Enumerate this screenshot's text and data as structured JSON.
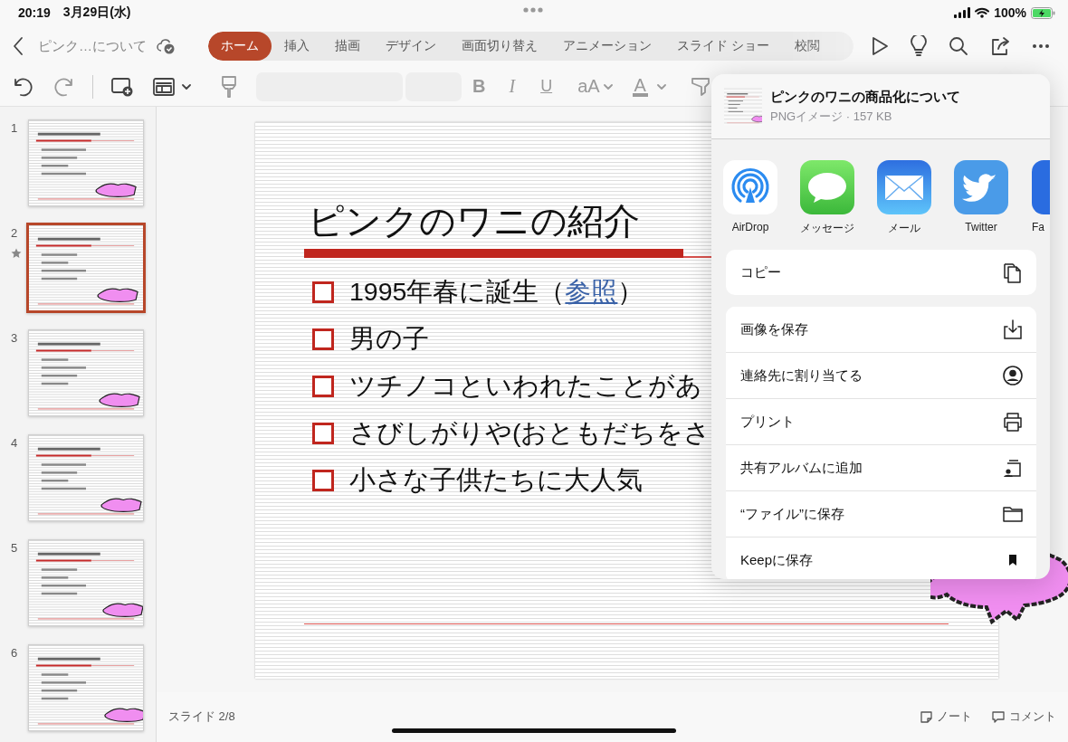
{
  "status_bar": {
    "time": "20:19",
    "date": "3月29日(水)",
    "battery": "100%"
  },
  "toolbar": {
    "document_title": "ピンク…について",
    "tabs": [
      {
        "label": "ホーム",
        "selected": true
      },
      {
        "label": "挿入",
        "selected": false
      },
      {
        "label": "描画",
        "selected": false
      },
      {
        "label": "デザイン",
        "selected": false
      },
      {
        "label": "画面切り替え",
        "selected": false
      },
      {
        "label": "アニメーション",
        "selected": false
      },
      {
        "label": "スライド ショー",
        "selected": false
      },
      {
        "label": "校閲",
        "selected": false
      }
    ]
  },
  "ribbon": {
    "tools": [
      {
        "kind": "undo",
        "disabled": false
      },
      {
        "kind": "redo",
        "disabled": true
      },
      {
        "kind": "new-slide",
        "disabled": false
      },
      {
        "kind": "layout",
        "disabled": false
      },
      {
        "kind": "format-painter",
        "disabled": true
      },
      {
        "kind": "font-name",
        "disabled": true
      },
      {
        "kind": "font-size",
        "disabled": true
      },
      {
        "kind": "bold",
        "label": "B",
        "disabled": true
      },
      {
        "kind": "italic",
        "label": "I",
        "disabled": true
      },
      {
        "kind": "underline",
        "label": "U",
        "disabled": true
      },
      {
        "kind": "size-change",
        "label": "aA",
        "disabled": true
      },
      {
        "kind": "font-color",
        "label": "A",
        "disabled": true
      },
      {
        "kind": "highlight",
        "disabled": true
      }
    ]
  },
  "slides": [
    {
      "number": "1",
      "selected": false,
      "starred": false
    },
    {
      "number": "2",
      "selected": true,
      "starred": true
    },
    {
      "number": "3",
      "selected": false,
      "starred": false
    },
    {
      "number": "4",
      "selected": false,
      "starred": false
    },
    {
      "number": "5",
      "selected": false,
      "starred": false
    },
    {
      "number": "6",
      "selected": false,
      "starred": false
    }
  ],
  "slide": {
    "title": "ピンクのワニの紹介",
    "bullets": [
      {
        "text": "1995年春に誕生（",
        "link": "参照",
        "tail": "）"
      },
      {
        "text": "男の子"
      },
      {
        "text": "ツチノコといわれたことがあ"
      },
      {
        "text": "さびしがりや(おともだちをさ"
      },
      {
        "text": "小さな子供たちに大人気"
      }
    ]
  },
  "footer": {
    "slide_indicator": "スライド 2/8",
    "notes": "ノート",
    "comments": "コメント"
  },
  "share_sheet": {
    "file_title": "ピンクのワニの商品化について",
    "file_info": "PNGイメージ · 157 KB",
    "apps": [
      {
        "kind": "airdrop",
        "label": "AirDrop"
      },
      {
        "kind": "messages",
        "label": "メッセージ"
      },
      {
        "kind": "mail",
        "label": "メール"
      },
      {
        "kind": "twitter",
        "label": "Twitter"
      },
      {
        "kind": "facebook",
        "label": "Fa"
      }
    ],
    "action_groups": [
      [
        {
          "kind": "copy",
          "label": "コピー"
        }
      ],
      [
        {
          "kind": "save-image",
          "label": "画像を保存"
        },
        {
          "kind": "contact",
          "label": "連絡先に割り当てる"
        },
        {
          "kind": "print",
          "label": "プリント"
        },
        {
          "kind": "shared-album",
          "label": "共有アルバムに追加"
        },
        {
          "kind": "files",
          "label": "“ファイル”に保存"
        },
        {
          "kind": "keep",
          "label": "Keepに保存"
        }
      ]
    ]
  }
}
